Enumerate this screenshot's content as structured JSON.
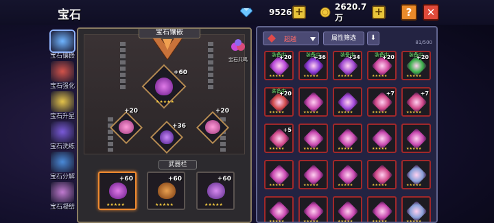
{
  "header": {
    "title": "宝石",
    "diamonds": "9526",
    "gold": "2620.7万",
    "help": "?",
    "close": "✕"
  },
  "sidebar": [
    {
      "label": "宝石镶嵌",
      "color": "#6fb4ff"
    },
    {
      "label": "宝石强化",
      "color": "#d2534a"
    },
    {
      "label": "宝石升星",
      "color": "#e4c34a"
    },
    {
      "label": "宝石洗练",
      "color": "#7a5ad8"
    },
    {
      "label": "宝石分解",
      "color": "#4a8ad8"
    },
    {
      "label": "宝石凝结",
      "color": "#c07ad0"
    }
  ],
  "left_panel": {
    "heading": "宝石镶嵌",
    "resonance": "宝石共鸣",
    "top_gem": "+60",
    "left_gem": "+20",
    "center_gem": "+36",
    "right_gem": "+20",
    "weapon_label": "武器栏",
    "weapon_slots": [
      "+60",
      "+60",
      "+60"
    ]
  },
  "right_panel": {
    "filter_rarity": "超越",
    "filter_attr": "属性筛选",
    "sort_icon": "⬇",
    "count": "81/500",
    "equipped_label": "装备中",
    "cells": [
      {
        "p": "+20",
        "eq": true,
        "c": "#b84ad8"
      },
      {
        "p": "+36",
        "eq": true,
        "c": "#8a3ad8"
      },
      {
        "p": "+34",
        "eq": true,
        "c": "#a04ad0"
      },
      {
        "p": "+20",
        "eq": true,
        "c": "#d04aa0"
      },
      {
        "p": "+20",
        "eq": true,
        "c": "#3ab04a"
      },
      {
        "p": "+20",
        "eq": true,
        "c": "#d04a4a"
      },
      {
        "p": "",
        "eq": false,
        "c": "#c84ab0"
      },
      {
        "p": "",
        "eq": false,
        "c": "#a04ad8"
      },
      {
        "p": "+7",
        "eq": false,
        "c": "#d04a8a"
      },
      {
        "p": "+7",
        "eq": false,
        "c": "#d04a8a"
      },
      {
        "p": "+5",
        "eq": false,
        "c": "#d04a8a"
      },
      {
        "p": "",
        "eq": false,
        "c": "#c84ab0"
      },
      {
        "p": "",
        "eq": false,
        "c": "#c84ab0"
      },
      {
        "p": "",
        "eq": false,
        "c": "#c84ab0"
      },
      {
        "p": "",
        "eq": false,
        "c": "#c84ab0"
      },
      {
        "p": "",
        "eq": false,
        "c": "#c84ab0"
      },
      {
        "p": "",
        "eq": false,
        "c": "#c84ab0"
      },
      {
        "p": "",
        "eq": false,
        "c": "#c84ab0"
      },
      {
        "p": "",
        "eq": false,
        "c": "#d04a8a"
      },
      {
        "p": "",
        "eq": false,
        "c": "#8aa0d8"
      },
      {
        "p": "",
        "eq": false,
        "c": "#c84ab0"
      },
      {
        "p": "",
        "eq": false,
        "c": "#c84ab0"
      },
      {
        "p": "",
        "eq": false,
        "c": "#c84ab0"
      },
      {
        "p": "",
        "eq": false,
        "c": "#c84ab0"
      },
      {
        "p": "",
        "eq": false,
        "c": "#8aa0d8"
      }
    ]
  }
}
